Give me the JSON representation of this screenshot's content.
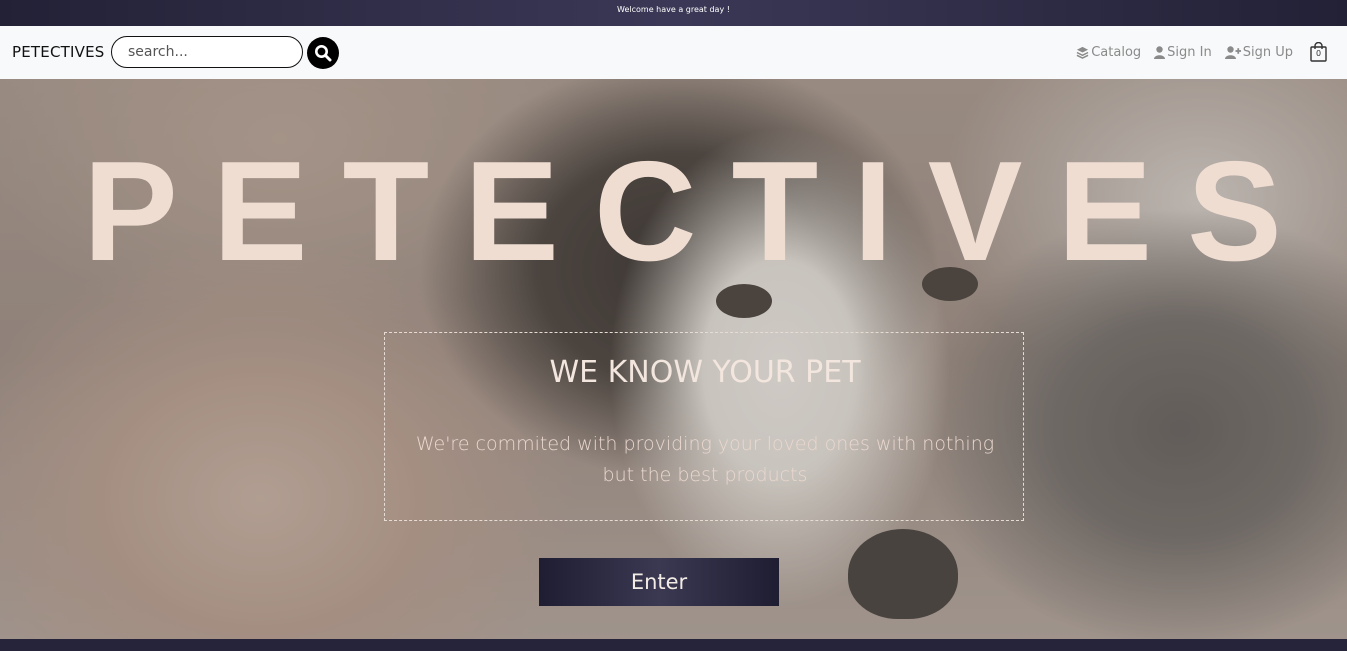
{
  "top_banner": {
    "text": "Welcome have a great day !"
  },
  "navbar": {
    "brand": "PETECTIVES",
    "search": {
      "placeholder": "search...",
      "value": ""
    },
    "links": [
      {
        "label": "Catalog",
        "icon": "layers-icon"
      },
      {
        "label": "Sign In",
        "icon": "user-icon"
      },
      {
        "label": "Sign Up",
        "icon": "user-plus-icon"
      }
    ],
    "cart": {
      "count": "0",
      "icon": "shopping-bag-icon"
    }
  },
  "hero": {
    "title": "PETECTIVES",
    "subtitle": "WE KNOW YOUR PET",
    "description": "We're commited with providing your loved ones with nothing but the best products",
    "button_label": "Enter"
  },
  "colors": {
    "top_banner": "#2e2c45",
    "navbar_bg": "#f8f9fa",
    "hero_title": "#efddd2",
    "enter_button": "#2c2a42",
    "footer": "#26243a"
  }
}
